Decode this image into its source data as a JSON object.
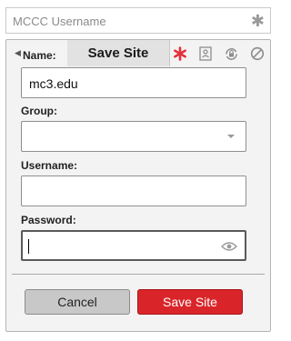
{
  "topbar": {
    "placeholder": "MCCC Username",
    "required_mark": "✱"
  },
  "header": {
    "name_label": "Name:",
    "title": "Save Site",
    "icons": [
      "asterisk-icon",
      "contact-card-icon",
      "lock-sync-icon",
      "block-icon"
    ]
  },
  "form": {
    "name_value": "mc3.edu",
    "group_label": "Group:",
    "group_value": "",
    "username_label": "Username:",
    "username_value": "",
    "password_label": "Password:",
    "password_value": ""
  },
  "buttons": {
    "cancel_label": "Cancel",
    "save_label": "Save Site"
  },
  "colors": {
    "accent_red": "#d9252a",
    "asterisk_red": "#e2323a"
  }
}
